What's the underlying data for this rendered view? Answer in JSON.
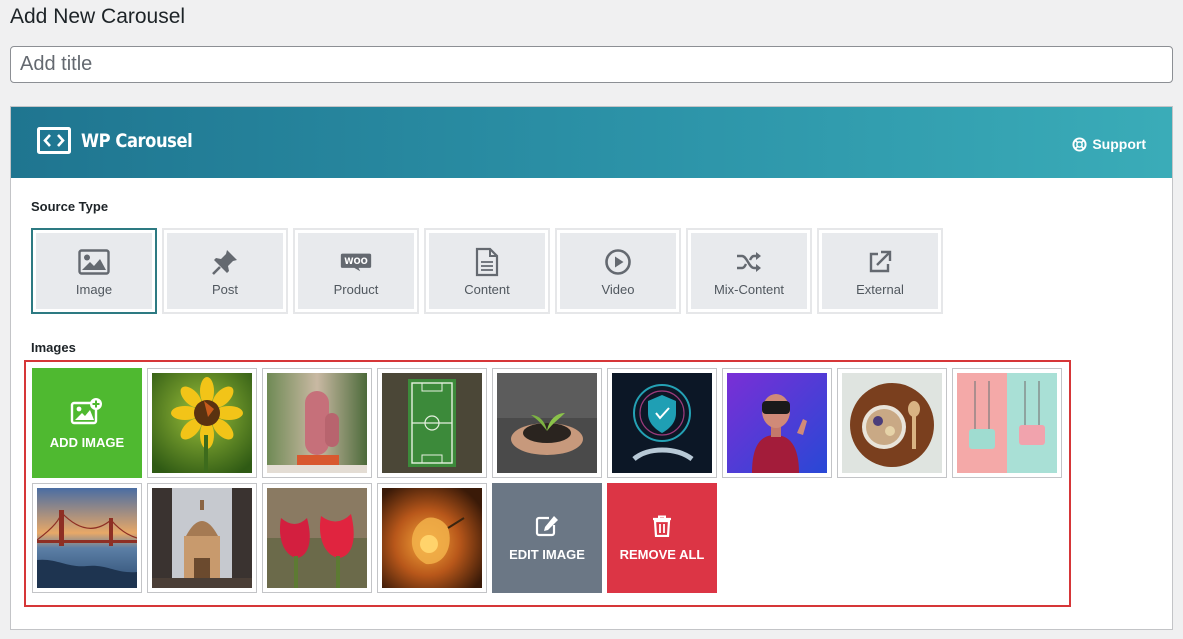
{
  "page": {
    "title": "Add New Carousel"
  },
  "title_input": {
    "placeholder": "Add title"
  },
  "header": {
    "brand": "WP Carousel",
    "support_label": "Support",
    "gradient": [
      "#1f7590",
      "#3aacb8"
    ]
  },
  "source_type": {
    "label": "Source Type",
    "selected": "Image",
    "options": [
      {
        "label": "Image",
        "icon": "image-icon"
      },
      {
        "label": "Post",
        "icon": "pin-icon"
      },
      {
        "label": "Product",
        "icon": "woo-icon"
      },
      {
        "label": "Content",
        "icon": "document-icon"
      },
      {
        "label": "Video",
        "icon": "play-icon"
      },
      {
        "label": "Mix-Content",
        "icon": "shuffle-icon"
      },
      {
        "label": "External",
        "icon": "external-link-icon"
      }
    ]
  },
  "images": {
    "label": "Images",
    "add_label": "ADD IMAGE",
    "edit_label": "EDIT IMAGE",
    "remove_label": "REMOVE ALL",
    "thumbnails": [
      "sunflower with butterfly",
      "cactus in pot",
      "soccer field aerial",
      "hands holding plant seedling",
      "shield security hologram",
      "person with VR headset",
      "bowl of food on wooden board",
      "pastel handbags",
      "golden gate bridge at sunset",
      "domed building",
      "red tulips",
      "glowing physalis"
    ],
    "colors": {
      "add": "#4fb930",
      "edit": "#6b7785",
      "remove": "#dc3545",
      "highlight_border": "#d63638"
    }
  }
}
